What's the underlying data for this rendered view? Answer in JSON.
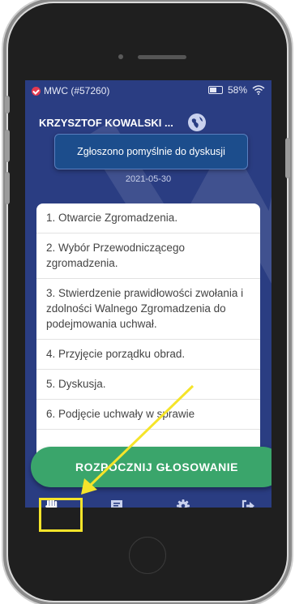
{
  "statusbar": {
    "app_label": "MWC (#57260)",
    "battery_percent": "58%",
    "icons": [
      "check-badge-icon",
      "battery-icon",
      "wifi-icon"
    ]
  },
  "header": {
    "user_name": "KRZYSZTOF KOWALSKI ...",
    "globe_icon": "globe-icon"
  },
  "toast": {
    "message": "Zgłoszono pomyślnie do dyskusji"
  },
  "meeting": {
    "date": "2021-05-30"
  },
  "agenda": {
    "items": [
      {
        "label": "1. Otwarcie Zgromadzenia."
      },
      {
        "label": "2. Wybór Przewodniczącego zgromadzenia."
      },
      {
        "label": "3. Stwierdzenie prawidłowości zwołania i zdolności Walnego Zgromadzenia do podejmowania uchwał."
      },
      {
        "label": "4. Przyjęcie porządku obrad."
      },
      {
        "label": "5. Dyskusja."
      },
      {
        "label": "6. Podjęcie uchwały w sprawie"
      }
    ]
  },
  "action": {
    "start_voting_label": "ROZPOCZNIJ GŁOSOWANIE"
  },
  "tabbar": {
    "tabs": [
      {
        "icon": "hand-icon",
        "active": true
      },
      {
        "icon": "chat-icon",
        "active": false
      },
      {
        "icon": "gear-icon",
        "active": false
      },
      {
        "icon": "logout-icon",
        "active": false
      }
    ]
  },
  "colors": {
    "screen_bg": "#2a3d82",
    "accent_green": "#3aa56b",
    "highlight": "#f5e42a",
    "toast_bg": "#1c4d8c"
  }
}
